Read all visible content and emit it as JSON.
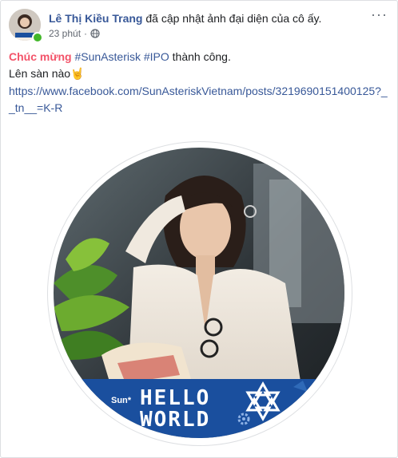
{
  "post": {
    "author": "Lê Thị Kiều Trang",
    "action": "đã cập nhật ảnh đại diện của cô ấy.",
    "time": "23 phút",
    "more_label": "···",
    "greeting": "Chúc mừng",
    "hashtag1": "#SunAsterisk",
    "hashtag2": "#IPO",
    "tail": "thành công.",
    "line2": "Lên sàn nào",
    "emoji": "🤘",
    "link": "https://www.facebook.com/SunAsteriskVietnam/posts/3219690151400125?__tn__=K-R"
  },
  "frame": {
    "brand": "Sun*",
    "word1": "HELLO",
    "word2": "WORLD"
  },
  "colors": {
    "author": "#385898",
    "greeting": "#f35369",
    "online": "#42b72a",
    "frame_banner": "#1a4f9e"
  },
  "icons": {
    "privacy": "globe-icon",
    "more": "ellipsis-icon",
    "logo": "sun-asterisk-logo-icon",
    "gear": "gear-icon"
  }
}
